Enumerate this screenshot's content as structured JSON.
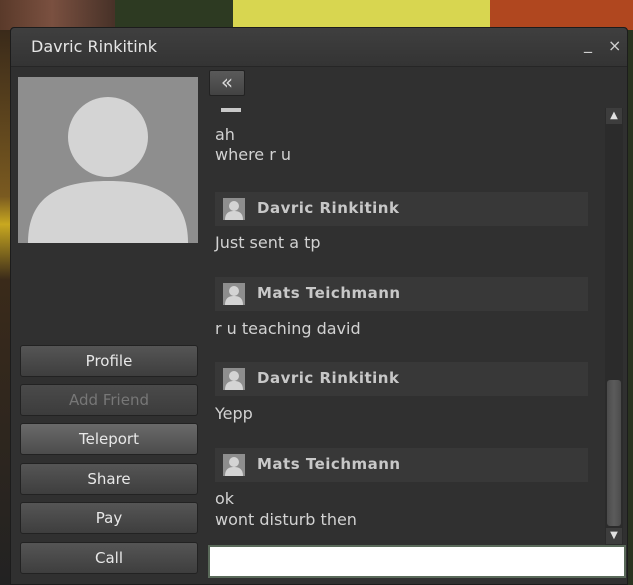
{
  "window": {
    "title": "Davric Rinkitink",
    "minimize_label": "_",
    "close_label": "×"
  },
  "sidebar": {
    "avatar": "default-avatar",
    "buttons": [
      {
        "label": "Profile",
        "enabled": true
      },
      {
        "label": "Add Friend",
        "enabled": false
      },
      {
        "label": "Teleport",
        "enabled": true
      },
      {
        "label": "Share",
        "enabled": true
      },
      {
        "label": "Pay",
        "enabled": true
      },
      {
        "label": "Call",
        "enabled": true
      }
    ]
  },
  "chat": {
    "collapse_label": "«",
    "messages": [
      {
        "lines": [
          "ah",
          "where r u"
        ]
      },
      {
        "sender": "Davric Rinkitink",
        "lines": [
          "Just sent a tp"
        ]
      },
      {
        "sender": "Mats Teichmann",
        "lines": [
          "r u teaching david"
        ]
      },
      {
        "sender": "Davric Rinkitink",
        "lines": [
          "Yepp"
        ]
      },
      {
        "sender": "Mats Teichmann",
        "lines": [
          "ok",
          "wont disturb then"
        ]
      }
    ],
    "scroll_up": "▲",
    "scroll_down": "▼"
  },
  "input": {
    "value": "",
    "placeholder": ""
  },
  "colors": {
    "window_bg": "#303030",
    "header_bg": "#383838",
    "text": "#d2d2d2"
  }
}
